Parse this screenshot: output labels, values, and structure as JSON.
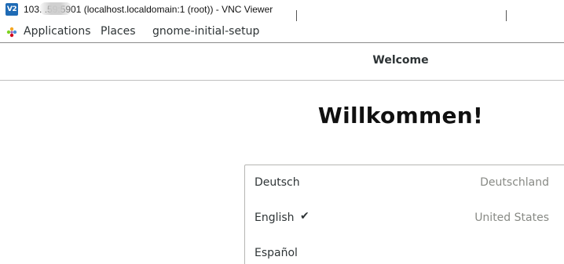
{
  "vnc_window": {
    "icon_text": "V2",
    "title": "103.        .59:5901 (localhost.localdomain:1 (root)) - VNC Viewer"
  },
  "panel": {
    "applications": "Applications",
    "places": "Places",
    "app_name": "gnome-initial-setup"
  },
  "header": {
    "title": "Welcome"
  },
  "main": {
    "heading": "Willkommen!",
    "languages": [
      {
        "name": "Deutsch",
        "region": "Deutschland",
        "selected": false
      },
      {
        "name": "English",
        "region": "United States",
        "selected": true,
        "check": "✔"
      },
      {
        "name": "Español",
        "region": "",
        "selected": false
      }
    ]
  }
}
